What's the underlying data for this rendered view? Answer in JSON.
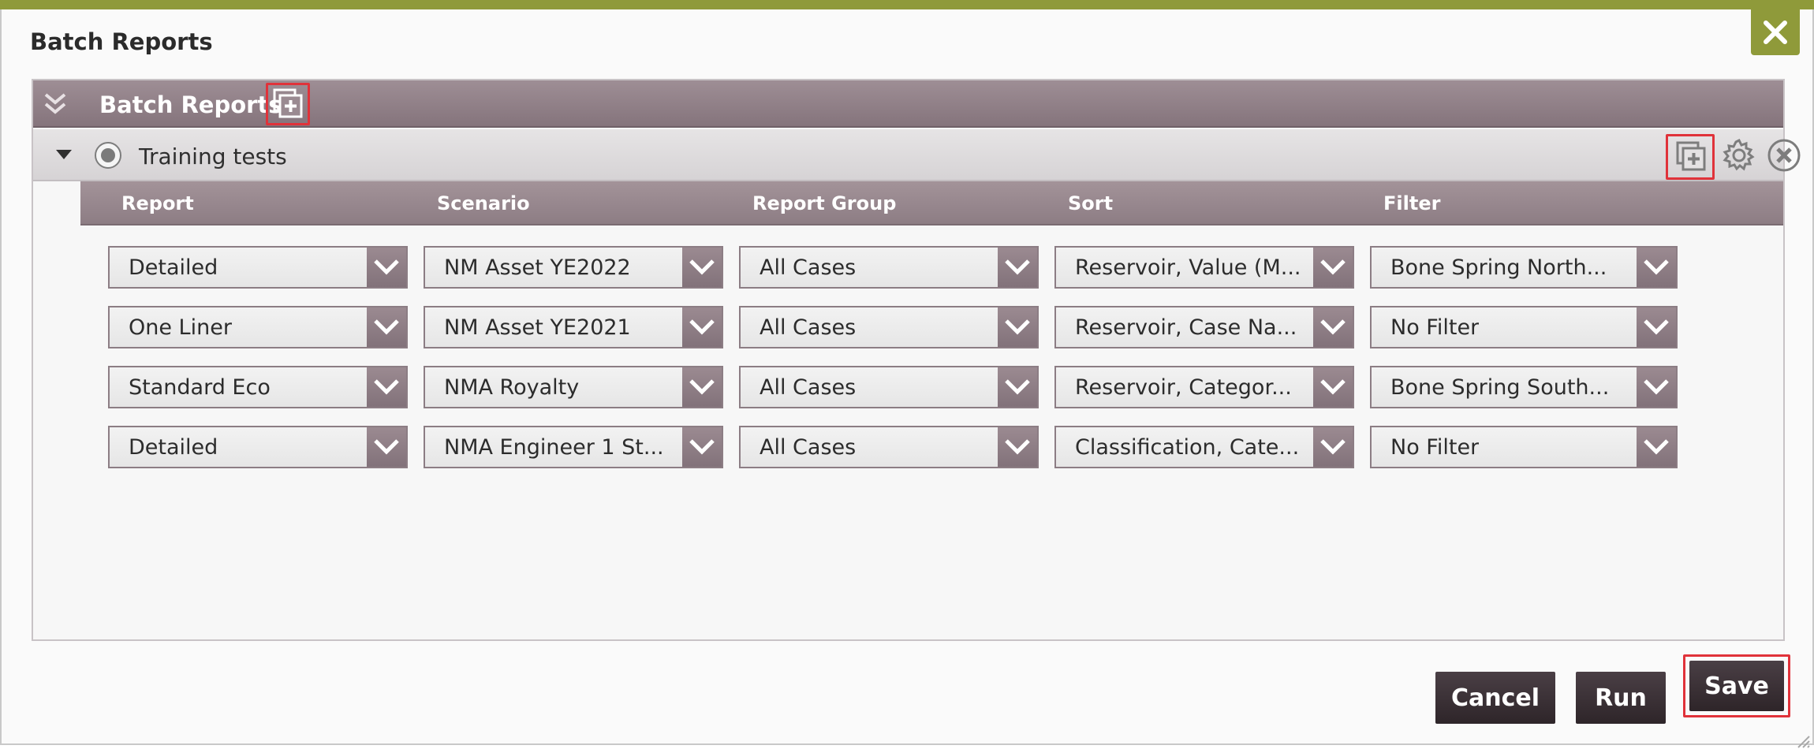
{
  "dialog": {
    "title": "Batch Reports"
  },
  "panel": {
    "title": "Batch Reports"
  },
  "group": {
    "title": "Training tests"
  },
  "columns": [
    "Report",
    "Scenario",
    "Report Group",
    "Sort",
    "Filter"
  ],
  "rows": [
    [
      "Detailed",
      "NM Asset YE2022",
      "All Cases",
      "Reservoir, Value (M...",
      "Bone Spring North..."
    ],
    [
      "One Liner",
      "NM Asset YE2021",
      "All Cases",
      "Reservoir, Case Na...",
      "No Filter"
    ],
    [
      "Standard Eco",
      "NMA Royalty",
      "All Cases",
      "Reservoir, Categor...",
      "Bone Spring South..."
    ],
    [
      "Detailed",
      "NMA Engineer 1 St...",
      "All Cases",
      "Classification, Cate...",
      "No Filter"
    ]
  ],
  "buttons": {
    "cancel": "Cancel",
    "run": "Run",
    "save": "Save"
  },
  "icons": {
    "close": "close-icon",
    "collapse": "double-chevron-down-icon",
    "add": "add-copy-icon",
    "settings": "gear-icon",
    "remove": "circle-x-icon",
    "dropdown": "chevron-down-icon"
  },
  "colors": {
    "accent": "#8f9a3a",
    "header": "#8d7d84",
    "highlight": "#e0323a",
    "button": "#2e2529"
  }
}
